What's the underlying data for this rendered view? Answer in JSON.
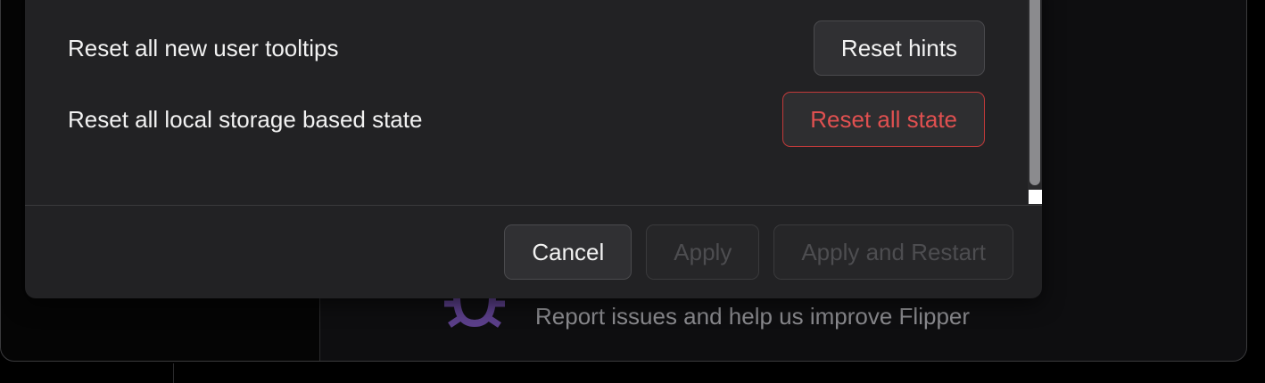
{
  "settings": {
    "rows": [
      {
        "label": "Reset all new user tooltips",
        "button": "Reset hints"
      },
      {
        "label": "Reset all local storage based state",
        "button": "Reset all state"
      }
    ]
  },
  "footer": {
    "cancel_label": "Cancel",
    "apply_label": "Apply",
    "apply_restart_label": "Apply and Restart"
  },
  "background": {
    "report_text": "Report issues and help us improve Flipper",
    "report_icon": "bug-icon"
  },
  "colors": {
    "modal_bg": "#222224",
    "danger": "#e05050",
    "accent_purple": "#5b3f8a"
  }
}
